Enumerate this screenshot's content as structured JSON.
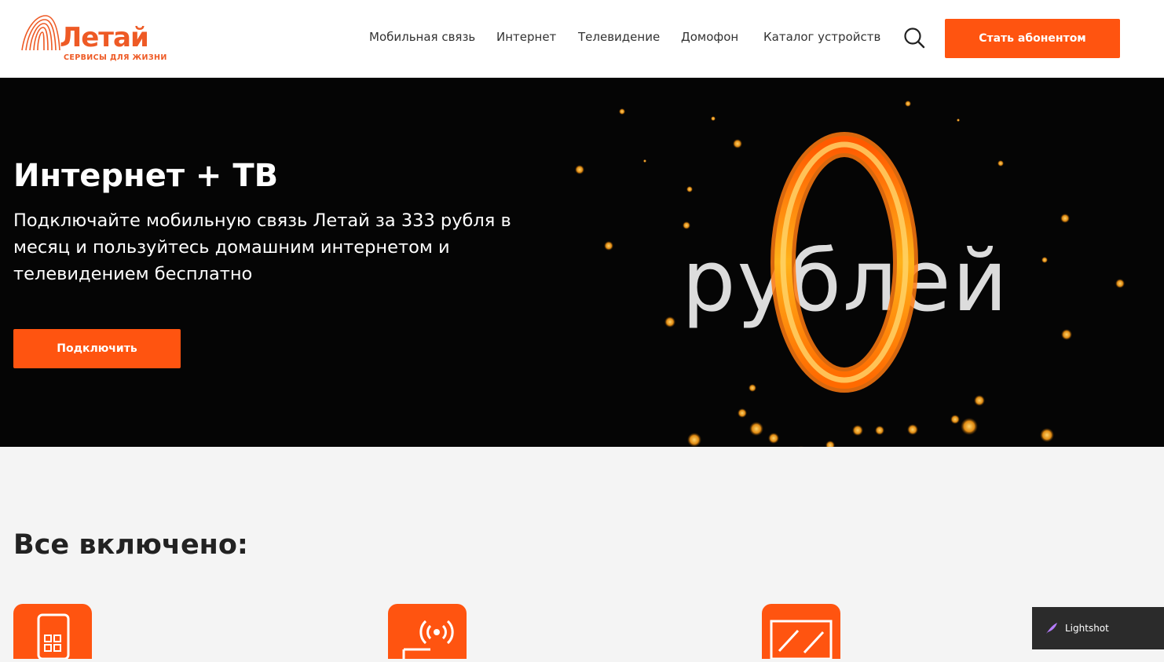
{
  "brand": {
    "name": "Летай",
    "tagline": "СЕРВИСЫ ДЛЯ ЖИЗНИ",
    "color": "#ff5410"
  },
  "nav": {
    "items": [
      {
        "label": "Мобильная связь"
      },
      {
        "label": "Интернет"
      },
      {
        "label": "Телевидение"
      },
      {
        "label": "Домофон"
      },
      {
        "label": "Каталог устройств"
      }
    ],
    "search_icon": "search-icon",
    "cta_label": "Стать абонентом"
  },
  "hero": {
    "title": "Интернет + ТВ",
    "subtitle": "Подключайте мобильную связь Летай за 333 рубля в месяц и пользуйтесь домашним интернетом и телевидением бесплатно",
    "button_label": "Подключить",
    "promo_word": "рублей",
    "promo_number": "0"
  },
  "features": {
    "title": "Все включено:",
    "icons": [
      "smartphone-apps-icon",
      "router-wifi-icon",
      "tv-screen-icon"
    ]
  },
  "lightshot": {
    "label": "Lightshot"
  }
}
